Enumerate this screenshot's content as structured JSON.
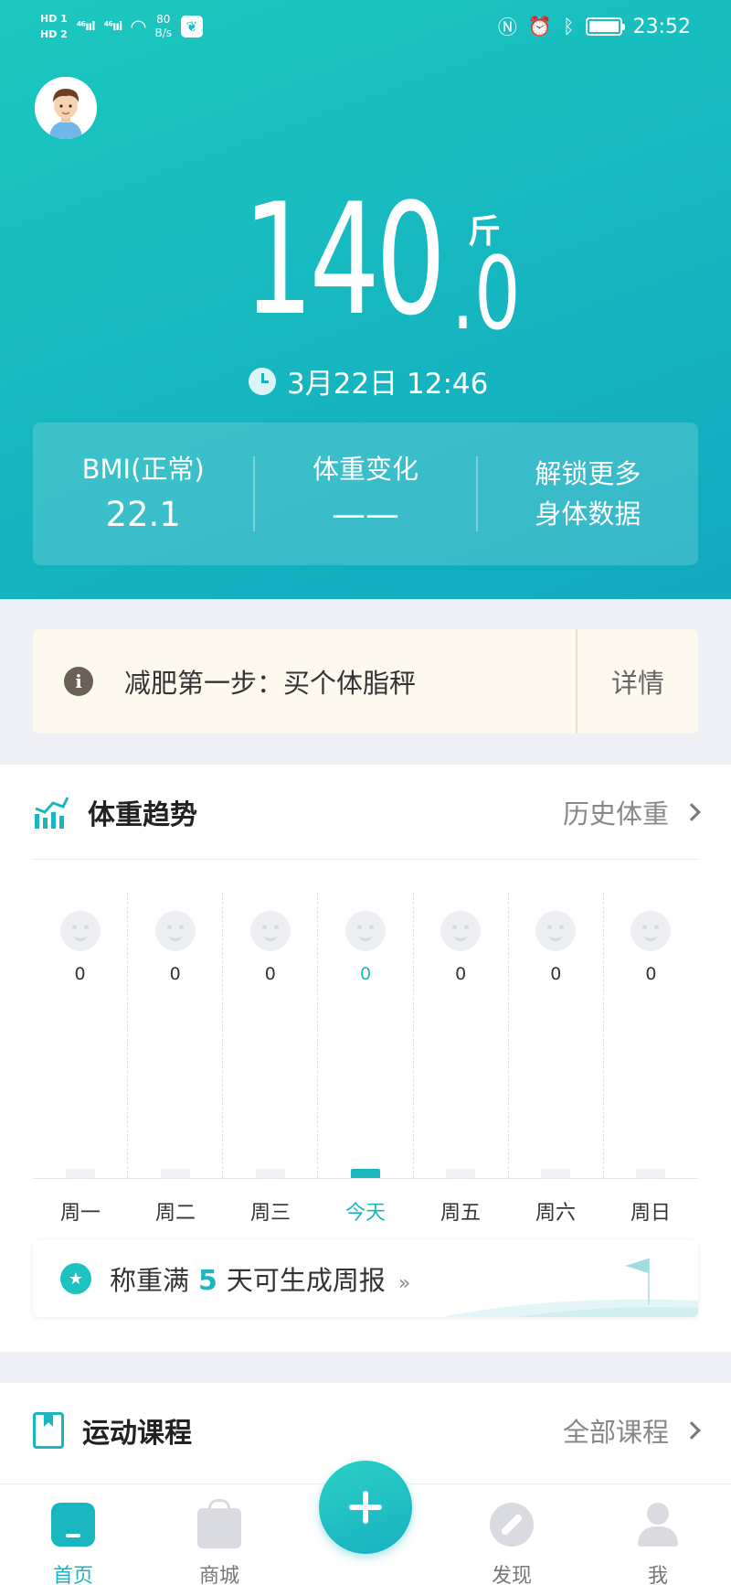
{
  "status_bar": {
    "hd1": "HD 1",
    "hd2": "HD 2",
    "signal1": "⁴⁶ııl",
    "signal2": "⁴⁶ııl",
    "net_rate_value": "80",
    "net_rate_unit": "B/s",
    "time": "23:52",
    "icons": [
      "nfc-icon",
      "alarm-icon",
      "bluetooth-icon",
      "battery-icon"
    ]
  },
  "hero": {
    "weight_int": "140",
    "weight_dec": ".0",
    "unit": "斤",
    "datetime": "3月22日 12:46"
  },
  "stats": [
    {
      "label": "BMI(正常)",
      "value": "22.1"
    },
    {
      "label": "体重变化",
      "value": "——"
    },
    {
      "label": "解锁更多",
      "value": "身体数据"
    }
  ],
  "tip": {
    "text": "减肥第一步：买个体脂秤",
    "button": "详情"
  },
  "trend": {
    "title": "体重趋势",
    "link": "历史体重",
    "days": [
      {
        "label": "周一",
        "value": "0",
        "today": false
      },
      {
        "label": "周二",
        "value": "0",
        "today": false
      },
      {
        "label": "周三",
        "value": "0",
        "today": false
      },
      {
        "label": "今天",
        "value": "0",
        "today": true
      },
      {
        "label": "周五",
        "value": "0",
        "today": false
      },
      {
        "label": "周六",
        "value": "0",
        "today": false
      },
      {
        "label": "周日",
        "value": "0",
        "today": false
      }
    ],
    "report_prefix": "称重满",
    "report_num": "5",
    "report_suffix": "天可生成周报",
    "report_arrow": "»"
  },
  "courses": {
    "title": "运动课程",
    "link": "全部课程"
  },
  "tabbar": {
    "home": "首页",
    "shop": "商城",
    "discover": "发现",
    "me": "我"
  },
  "colors": {
    "accent": "#19b6bf",
    "hero_gradient_start": "#1cc8be",
    "hero_gradient_end": "#13a9bf"
  }
}
